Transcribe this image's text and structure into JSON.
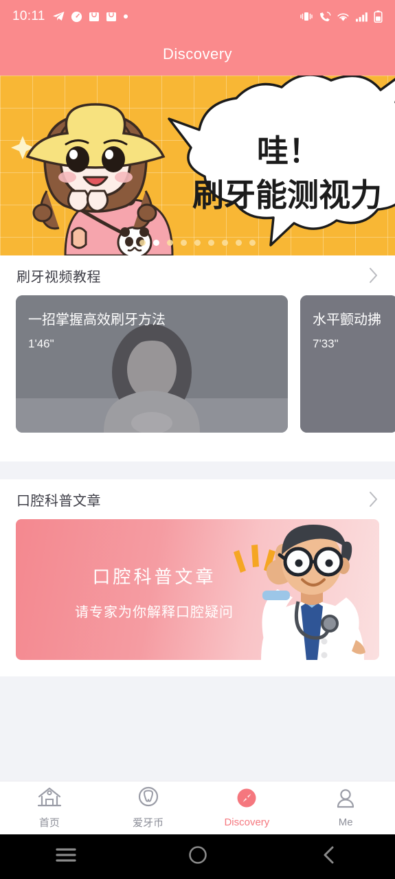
{
  "status_bar": {
    "time": "10:11",
    "left_icons": [
      "telegram-icon",
      "clock-icon",
      "shopping-bag-icon",
      "shopping-bag-icon",
      "dot-icon"
    ],
    "right_icons": [
      "vibrate-icon",
      "call-icon",
      "wifi-icon",
      "signal-icon",
      "battery-icon"
    ]
  },
  "header": {
    "title": "Discovery"
  },
  "banner": {
    "bubble_line1": "哇！",
    "bubble_line2": "刷牙能测视力",
    "dot_count": 9,
    "active_dot": 2,
    "background_color": "#f8b735"
  },
  "sections": {
    "videos": {
      "title": "刷牙视频教程",
      "more_icon": "chevron-right-icon",
      "items": [
        {
          "title": "一招掌握高效刷牙方法",
          "duration": "1'46\""
        },
        {
          "title": "水平颤动拂",
          "duration": "7'33\""
        }
      ]
    },
    "articles": {
      "title": "口腔科普文章",
      "more_icon": "chevron-right-icon",
      "banner": {
        "title": "口腔科普文章",
        "subtitle": "请专家为你解释口腔疑问"
      }
    }
  },
  "tab_bar": {
    "active_color": "#f5777e",
    "inactive_color": "#8d8f99",
    "items": [
      {
        "label": "首页",
        "icon": "home-icon",
        "active": false
      },
      {
        "label": "爱牙币",
        "icon": "tooth-coin-icon",
        "active": false
      },
      {
        "label": "Discovery",
        "icon": "compass-icon",
        "active": true
      },
      {
        "label": "Me",
        "icon": "person-icon",
        "active": false
      }
    ]
  },
  "system_nav": {
    "items": [
      {
        "name": "recents-button",
        "icon": "menu-icon"
      },
      {
        "name": "home-button",
        "icon": "circle-icon"
      },
      {
        "name": "back-button",
        "icon": "chevron-left-icon"
      }
    ]
  }
}
